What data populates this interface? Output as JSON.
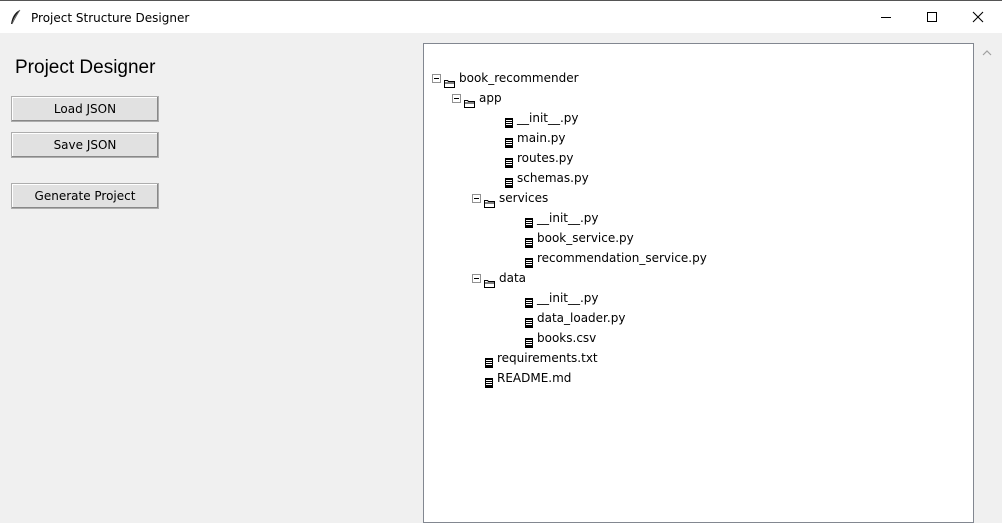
{
  "window": {
    "title": "Project Structure Designer",
    "icon": "feather-icon"
  },
  "panel": {
    "title": "Project Designer",
    "buttons": {
      "load": "Load JSON",
      "save": "Save JSON",
      "generate": "Generate Project"
    }
  },
  "tree": {
    "nodes": [
      {
        "label": "book_recommender",
        "type": "folder",
        "expanded": true,
        "depth": 0
      },
      {
        "label": "app",
        "type": "folder",
        "expanded": true,
        "depth": 1
      },
      {
        "label": "__init__.py",
        "type": "file",
        "depth": 2
      },
      {
        "label": "main.py",
        "type": "file",
        "depth": 2
      },
      {
        "label": "routes.py",
        "type": "file",
        "depth": 2
      },
      {
        "label": "schemas.py",
        "type": "file",
        "depth": 2
      },
      {
        "label": "services",
        "type": "folder",
        "expanded": true,
        "depth": 2
      },
      {
        "label": "__init__.py",
        "type": "file",
        "depth": 3
      },
      {
        "label": "book_service.py",
        "type": "file",
        "depth": 3
      },
      {
        "label": "recommendation_service.py",
        "type": "file",
        "depth": 3
      },
      {
        "label": "data",
        "type": "folder",
        "expanded": true,
        "depth": 2
      },
      {
        "label": "__init__.py",
        "type": "file",
        "depth": 3
      },
      {
        "label": "data_loader.py",
        "type": "file",
        "depth": 3
      },
      {
        "label": "books.csv",
        "type": "file",
        "depth": 3
      },
      {
        "label": "requirements.txt",
        "type": "file",
        "depth": 1
      },
      {
        "label": "README.md",
        "type": "file",
        "depth": 1
      }
    ]
  }
}
